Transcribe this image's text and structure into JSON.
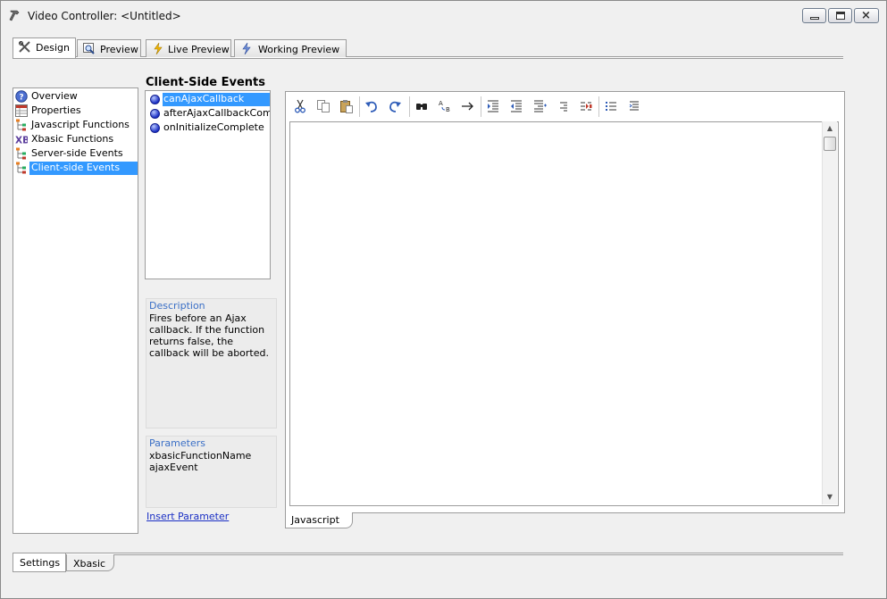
{
  "window": {
    "title": "Video Controller: <Untitled>",
    "controls": {
      "minimize": "minimize",
      "maximize": "maximize",
      "close": "close"
    }
  },
  "top_tabs": [
    {
      "label": "Design",
      "icon": "tools-icon",
      "active": true
    },
    {
      "label": "Preview",
      "icon": "magnifier-icon",
      "active": false
    },
    {
      "label": "Live Preview",
      "icon": "lightning-icon",
      "active": false
    },
    {
      "label": "Working Preview",
      "icon": "lightning-icon",
      "active": false
    }
  ],
  "left_nav": {
    "items": [
      {
        "label": "Overview",
        "icon": "help-icon",
        "selected": false
      },
      {
        "label": "Properties",
        "icon": "properties-icon",
        "selected": false
      },
      {
        "label": "Javascript Functions",
        "icon": "tree-icon",
        "selected": false
      },
      {
        "label": "Xbasic Functions",
        "icon": "xb-icon",
        "selected": false
      },
      {
        "label": "Server-side Events",
        "icon": "tree-icon",
        "selected": false
      },
      {
        "label": "Client-side Events",
        "icon": "tree-icon",
        "selected": true
      }
    ]
  },
  "events": {
    "title": "Client-Side Events",
    "items": [
      {
        "label": "canAjaxCallback",
        "selected": true
      },
      {
        "label": "afterAjaxCallbackComple",
        "selected": false
      },
      {
        "label": "onInitializeComplete",
        "selected": false
      }
    ]
  },
  "description": {
    "header": "Description",
    "text": "Fires before an Ajax callback. If the function returns false, the callback will be aborted."
  },
  "parameters": {
    "header": "Parameters",
    "line1": "xbasicFunctionName",
    "line2": "ajaxEvent"
  },
  "insert_parameter_label": "Insert Parameter",
  "editor": {
    "toolbar": [
      "cut",
      "copy",
      "paste",
      "undo",
      "redo",
      "find",
      "replace",
      "goto",
      "indent",
      "outdent",
      "comment",
      "uncomment",
      "format",
      "list",
      "outline"
    ],
    "code": "",
    "tab_label": "Javascript"
  },
  "bottom_tabs": [
    {
      "label": "Settings",
      "active": true
    },
    {
      "label": "Xbasic",
      "active": false
    }
  ],
  "colors": {
    "selection": "#3399ff",
    "link": "#1a2fc4",
    "section_header": "#3a6fc6"
  }
}
